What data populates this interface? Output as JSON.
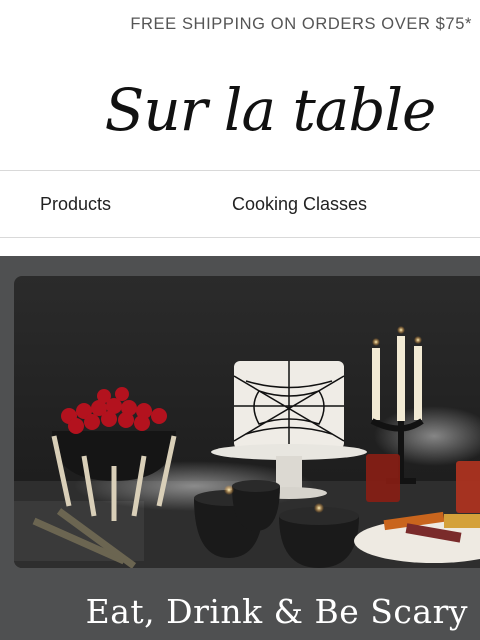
{
  "promo": {
    "text": "FREE SHIPPING ON ORDERS OVER $75*"
  },
  "brand": {
    "logo_text": "Sur la table"
  },
  "nav": {
    "items": [
      "Products",
      "Cooking Classes"
    ]
  },
  "hero": {
    "title": "Eat, Drink & Be Scary"
  },
  "colors": {
    "hero_background": "#4f5051",
    "promo_text": "#555555"
  }
}
